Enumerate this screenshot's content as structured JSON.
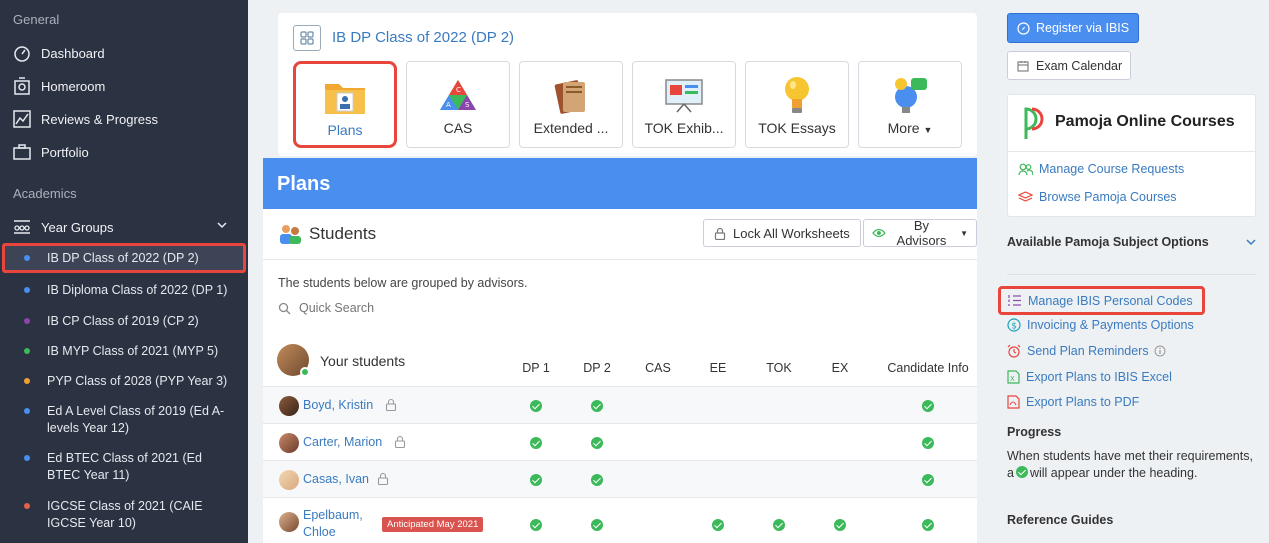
{
  "sidebar": {
    "section_general": "General",
    "nav": [
      {
        "label": "Dashboard",
        "icon": "dashboard-icon"
      },
      {
        "label": "Homeroom",
        "icon": "homeroom-icon"
      },
      {
        "label": "Reviews & Progress",
        "icon": "chart-line-icon"
      },
      {
        "label": "Portfolio",
        "icon": "briefcase-icon"
      }
    ],
    "section_academics": "Academics",
    "year_groups_label": "Year Groups",
    "groups": [
      {
        "label": "IB DP Class of 2022 (DP 2)",
        "color": "#4a8ff0",
        "active": true
      },
      {
        "label": "IB Diploma Class of 2022 (DP 1)",
        "color": "#4a8ff0"
      },
      {
        "label": "IB CP Class of 2019 (CP 2)",
        "color": "#8e44ad"
      },
      {
        "label": "IB MYP Class of 2021 (MYP 5)",
        "color": "#3cb95a"
      },
      {
        "label": "PYP Class of 2028 (PYP Year 3)",
        "color": "#f0a030"
      },
      {
        "label": "Ed A Level Class of 2019 (Ed A-levels Year 12)",
        "color": "#4a8ff0"
      },
      {
        "label": "Ed BTEC Class of 2021 (Ed BTEC Year 11)",
        "color": "#4a8ff0"
      },
      {
        "label": "IGCSE Class of 2021 (CAIE IGCSE Year 10)",
        "color": "#e8604c"
      }
    ]
  },
  "header": {
    "title": "IB DP Class of 2022 (DP 2)",
    "tiles": [
      {
        "label": "Plans",
        "icon": "plans-folder-icon",
        "selected": true
      },
      {
        "label": "CAS",
        "icon": "cas-triangle-icon"
      },
      {
        "label": "Extended ...",
        "icon": "books-icon"
      },
      {
        "label": "TOK Exhib...",
        "icon": "presentation-icon"
      },
      {
        "label": "TOK Essays",
        "icon": "lightbulb-icon"
      },
      {
        "label": "More",
        "icon": "more-apps-icon"
      }
    ]
  },
  "plans": {
    "banner_title": "Plans",
    "students_title": "Students",
    "lock_all_label": "Lock All Worksheets",
    "by_advisors_label": "By Advisors",
    "grouped_note": "The students below are grouped by advisors.",
    "search_placeholder": "Quick Search",
    "your_students_label": "Your students",
    "columns": [
      "DP 1",
      "DP 2",
      "CAS",
      "EE",
      "TOK",
      "EX",
      "Candidate Info"
    ],
    "students": [
      {
        "name": "Boyd, Kristin",
        "badge": "",
        "checks": [
          true,
          true,
          false,
          false,
          false,
          false,
          true
        ]
      },
      {
        "name": "Carter, Marion",
        "badge": "",
        "checks": [
          true,
          true,
          false,
          false,
          false,
          false,
          true
        ]
      },
      {
        "name": "Casas, Ivan",
        "badge": "",
        "checks": [
          true,
          true,
          false,
          false,
          false,
          false,
          true
        ]
      },
      {
        "name_line1": "Epelbaum,",
        "name_line2": "Chloe",
        "badge": "Anticipated May 2021",
        "checks": [
          true,
          true,
          false,
          true,
          true,
          true,
          true
        ]
      }
    ]
  },
  "right": {
    "register_label": "Register via IBIS",
    "exam_calendar_label": "Exam Calendar",
    "pamoja_title": "Pamoja Online Courses",
    "manage_requests_label": "Manage Course Requests",
    "browse_courses_label": "Browse Pamoja Courses",
    "available_options_label": "Available Pamoja Subject Options",
    "links": [
      {
        "label": "Manage IBIS Personal Codes",
        "icon": "list-numbered-icon",
        "highlighted": true
      },
      {
        "label": "Invoicing & Payments Options",
        "icon": "dollar-circle-icon"
      },
      {
        "label": "Send Plan Reminders",
        "icon": "alarm-clock-icon"
      },
      {
        "label": "Export Plans to IBIS Excel",
        "icon": "excel-file-icon"
      },
      {
        "label": "Export Plans to PDF",
        "icon": "pdf-file-icon"
      }
    ],
    "progress_heading": "Progress",
    "progress_text_1": "When students have met their requirements, a",
    "progress_text_2": "will appear under the heading.",
    "reference_guides": "Reference Guides"
  }
}
